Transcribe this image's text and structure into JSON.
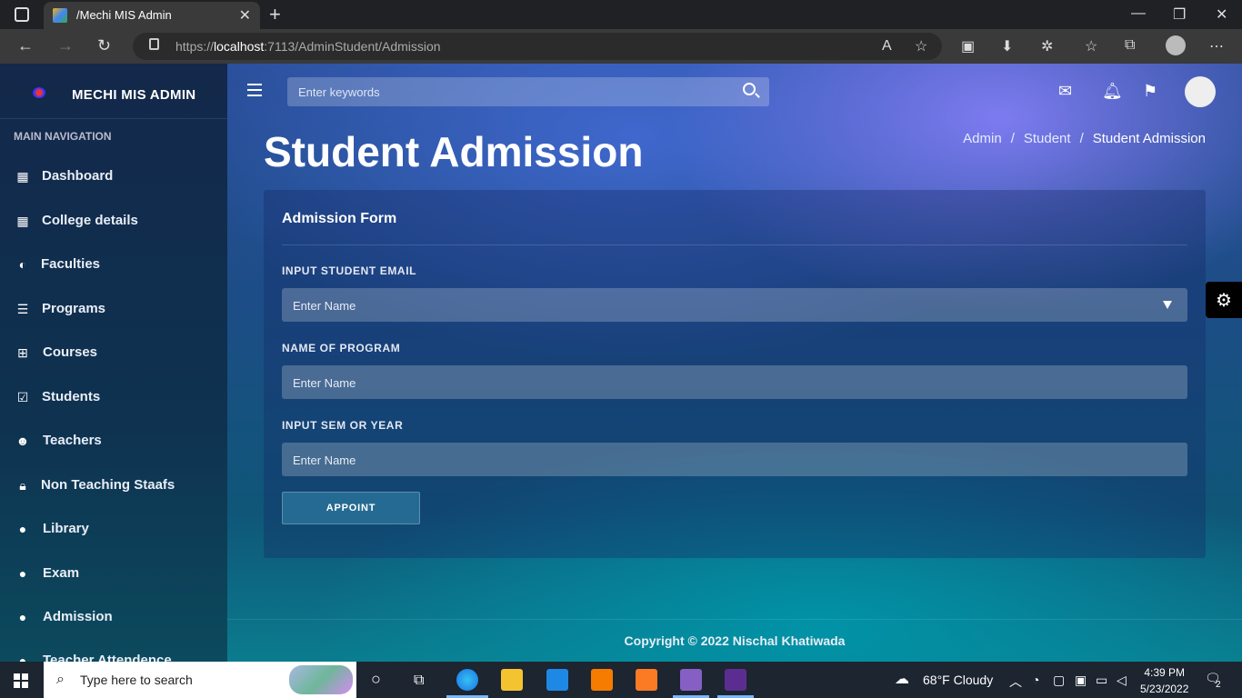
{
  "browser": {
    "tab_title": "/Mechi MIS Admin",
    "url_prefix": "https://",
    "url_host": "localhost",
    "url_rest": ":7113/AdminStudent/Admission"
  },
  "sidebar": {
    "brand": "MECHI MIS ADMIN",
    "section": "MAIN NAVIGATION",
    "items": [
      {
        "label": "Dashboard",
        "icon": "dashboard-icon"
      },
      {
        "label": "College details",
        "icon": "dashboard-icon"
      },
      {
        "label": "Faculties",
        "icon": "drop-icon"
      },
      {
        "label": "Programs",
        "icon": "list-icon"
      },
      {
        "label": "Courses",
        "icon": "grid-icon"
      },
      {
        "label": "Students",
        "icon": "calendar-check-icon"
      },
      {
        "label": "Teachers",
        "icon": "face-icon"
      },
      {
        "label": "Non Teaching Staafs",
        "icon": "lock-icon"
      },
      {
        "label": "Library",
        "icon": "user-icon"
      },
      {
        "label": "Exam",
        "icon": "user-icon"
      },
      {
        "label": "Admission",
        "icon": "user-icon"
      },
      {
        "label": "Teacher Attendence",
        "icon": "user-icon"
      }
    ]
  },
  "topbar": {
    "search_placeholder": "Enter keywords"
  },
  "page": {
    "title": "Student Admission",
    "breadcrumb": [
      "Admin",
      "Student",
      "Student Admission"
    ]
  },
  "form": {
    "title": "Admission Form",
    "fields": [
      {
        "label": "INPUT STUDENT EMAIL",
        "placeholder": "Enter Name",
        "type": "select"
      },
      {
        "label": "NAME OF PROGRAM",
        "placeholder": "Enter Name",
        "type": "text"
      },
      {
        "label": "INPUT SEM OR YEAR",
        "placeholder": "Enter Name",
        "type": "text"
      }
    ],
    "submit_label": "APPOINT"
  },
  "footer": "Copyright © 2022 Nischal Khatiwada",
  "taskbar": {
    "search_text": "Type here to search",
    "weather": "68°F  Cloudy",
    "time": "4:39 PM",
    "date": "5/23/2022",
    "notification_count": "2"
  }
}
